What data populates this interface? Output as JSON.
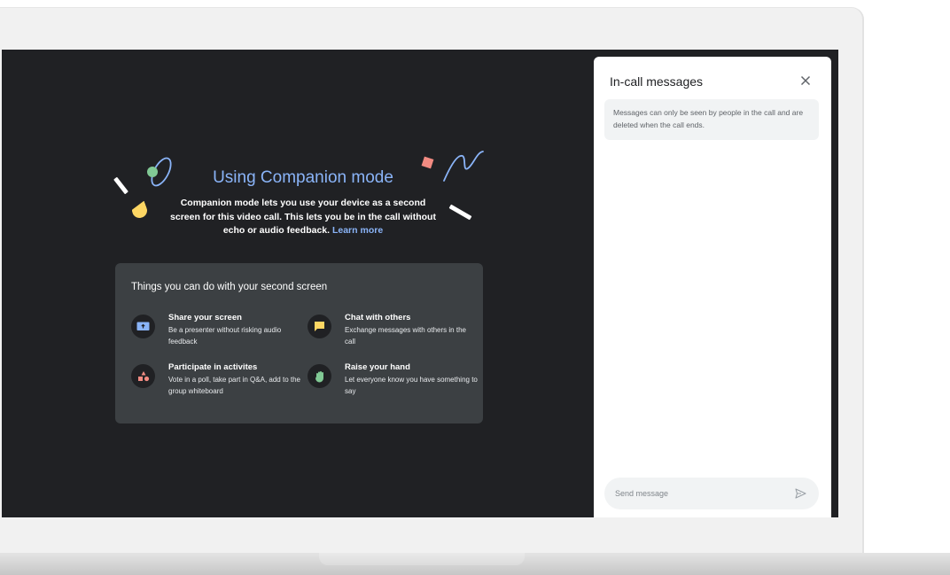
{
  "companion": {
    "title": "Using Companion mode",
    "body": "Companion mode lets you use your device as a second screen for this video call. This lets you be in the call without echo or audio feedback.",
    "learn_more": "Learn more"
  },
  "card": {
    "title": "Things you can do with your second screen",
    "features": [
      {
        "title": "Share your screen",
        "desc": "Be a presenter without risking audio feedback",
        "icon": "present-screen-icon"
      },
      {
        "title": "Chat with others",
        "desc": "Exchange messages with others in the call",
        "icon": "chat-icon"
      },
      {
        "title": "Participate in activites",
        "desc": "Vote in a poll, take part in Q&A, add to the group whiteboard",
        "icon": "activities-icon"
      },
      {
        "title": "Raise your hand",
        "desc": "Let everyone know you have something to say",
        "icon": "raise-hand-icon"
      }
    ]
  },
  "panel": {
    "title": "In-call messages",
    "notice": "Messages can only be seen by people in the call and are deleted when the call ends.",
    "send_placeholder": "Send message"
  },
  "colors": {
    "screen_bg": "#202124",
    "card_bg": "#3c4043",
    "accent_blue": "#8ab4f8",
    "panel_bg": "#ffffff",
    "chip_bg": "#f1f3f4"
  }
}
